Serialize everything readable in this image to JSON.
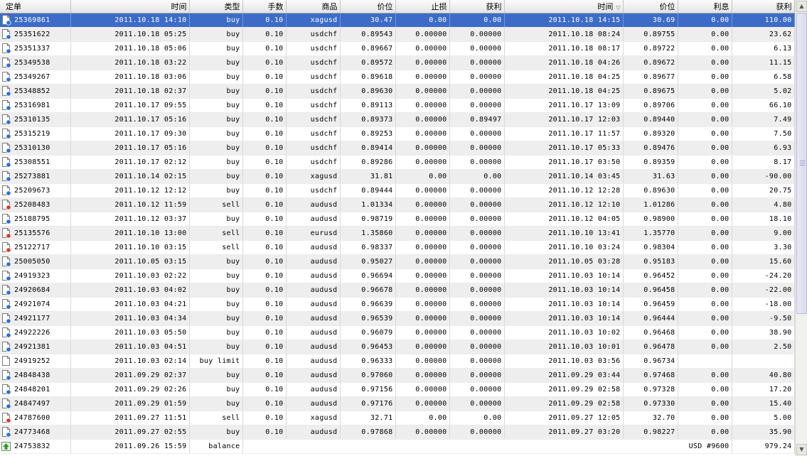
{
  "columns": [
    "定单",
    "时间",
    "类型",
    "手数",
    "商品",
    "价位",
    "止损",
    "获利",
    "时间",
    "价位",
    "利息",
    "获利"
  ],
  "rows": [
    {
      "ticket": "25369861",
      "open_time": "2011.10.18 14:10",
      "type": "buy",
      "lots": "0.10",
      "symbol": "xagusd",
      "open_price": "30.47",
      "sl": "0.00",
      "tp": "0.00",
      "close_time": "2011.10.18 14:15",
      "close_price": "30.69",
      "swap": "0.00",
      "profit": "110.00",
      "icon": "buy-order-icon"
    },
    {
      "ticket": "25351622",
      "open_time": "2011.10.18 05:25",
      "type": "buy",
      "lots": "0.10",
      "symbol": "usdchf",
      "open_price": "0.89543",
      "sl": "0.00000",
      "tp": "0.00000",
      "close_time": "2011.10.18 08:24",
      "close_price": "0.89755",
      "swap": "0.00",
      "profit": "23.62",
      "icon": "buy-order-icon"
    },
    {
      "ticket": "25351337",
      "open_time": "2011.10.18 05:06",
      "type": "buy",
      "lots": "0.10",
      "symbol": "usdchf",
      "open_price": "0.89667",
      "sl": "0.00000",
      "tp": "0.00000",
      "close_time": "2011.10.18 08:17",
      "close_price": "0.89722",
      "swap": "0.00",
      "profit": "6.13",
      "icon": "buy-order-icon"
    },
    {
      "ticket": "25349538",
      "open_time": "2011.10.18 03:22",
      "type": "buy",
      "lots": "0.10",
      "symbol": "usdchf",
      "open_price": "0.89572",
      "sl": "0.00000",
      "tp": "0.00000",
      "close_time": "2011.10.18 04:26",
      "close_price": "0.89672",
      "swap": "0.00",
      "profit": "11.15",
      "icon": "buy-order-icon"
    },
    {
      "ticket": "25349267",
      "open_time": "2011.10.18 03:06",
      "type": "buy",
      "lots": "0.10",
      "symbol": "usdchf",
      "open_price": "0.89618",
      "sl": "0.00000",
      "tp": "0.00000",
      "close_time": "2011.10.18 04:25",
      "close_price": "0.89677",
      "swap": "0.00",
      "profit": "6.58",
      "icon": "buy-order-icon"
    },
    {
      "ticket": "25348852",
      "open_time": "2011.10.18 02:37",
      "type": "buy",
      "lots": "0.10",
      "symbol": "usdchf",
      "open_price": "0.89630",
      "sl": "0.00000",
      "tp": "0.00000",
      "close_time": "2011.10.18 04:25",
      "close_price": "0.89675",
      "swap": "0.00",
      "profit": "5.02",
      "icon": "buy-order-icon"
    },
    {
      "ticket": "25316981",
      "open_time": "2011.10.17 09:55",
      "type": "buy",
      "lots": "0.10",
      "symbol": "usdchf",
      "open_price": "0.89113",
      "sl": "0.00000",
      "tp": "0.00000",
      "close_time": "2011.10.17 13:09",
      "close_price": "0.89706",
      "swap": "0.00",
      "profit": "66.10",
      "icon": "buy-order-icon"
    },
    {
      "ticket": "25310135",
      "open_time": "2011.10.17 05:16",
      "type": "buy",
      "lots": "0.10",
      "symbol": "usdchf",
      "open_price": "0.89373",
      "sl": "0.00000",
      "tp": "0.89497",
      "close_time": "2011.10.17 12:03",
      "close_price": "0.89440",
      "swap": "0.00",
      "profit": "7.49",
      "icon": "buy-order-icon"
    },
    {
      "ticket": "25315219",
      "open_time": "2011.10.17 09:30",
      "type": "buy",
      "lots": "0.10",
      "symbol": "usdchf",
      "open_price": "0.89253",
      "sl": "0.00000",
      "tp": "0.00000",
      "close_time": "2011.10.17 11:57",
      "close_price": "0.89320",
      "swap": "0.00",
      "profit": "7.50",
      "icon": "buy-order-icon"
    },
    {
      "ticket": "25310130",
      "open_time": "2011.10.17 05:16",
      "type": "buy",
      "lots": "0.10",
      "symbol": "usdchf",
      "open_price": "0.89414",
      "sl": "0.00000",
      "tp": "0.00000",
      "close_time": "2011.10.17 05:33",
      "close_price": "0.89476",
      "swap": "0.00",
      "profit": "6.93",
      "icon": "buy-order-icon"
    },
    {
      "ticket": "25308551",
      "open_time": "2011.10.17 02:12",
      "type": "buy",
      "lots": "0.10",
      "symbol": "usdchf",
      "open_price": "0.89286",
      "sl": "0.00000",
      "tp": "0.00000",
      "close_time": "2011.10.17 03:50",
      "close_price": "0.89359",
      "swap": "0.00",
      "profit": "8.17",
      "icon": "buy-order-icon"
    },
    {
      "ticket": "25273881",
      "open_time": "2011.10.14 02:15",
      "type": "buy",
      "lots": "0.10",
      "symbol": "xagusd",
      "open_price": "31.81",
      "sl": "0.00",
      "tp": "0.00",
      "close_time": "2011.10.14 03:45",
      "close_price": "31.63",
      "swap": "0.00",
      "profit": "-90.00",
      "icon": "buy-order-icon"
    },
    {
      "ticket": "25209673",
      "open_time": "2011.10.12 12:12",
      "type": "buy",
      "lots": "0.10",
      "symbol": "usdchf",
      "open_price": "0.89444",
      "sl": "0.00000",
      "tp": "0.00000",
      "close_time": "2011.10.12 12:28",
      "close_price": "0.89630",
      "swap": "0.00",
      "profit": "20.75",
      "icon": "buy-order-icon"
    },
    {
      "ticket": "25208483",
      "open_time": "2011.10.12 11:59",
      "type": "sell",
      "lots": "0.10",
      "symbol": "audusd",
      "open_price": "1.01334",
      "sl": "0.00000",
      "tp": "0.00000",
      "close_time": "2011.10.12 12:10",
      "close_price": "1.01286",
      "swap": "0.00",
      "profit": "4.80",
      "icon": "sell-order-icon"
    },
    {
      "ticket": "25188795",
      "open_time": "2011.10.12 03:37",
      "type": "buy",
      "lots": "0.10",
      "symbol": "audusd",
      "open_price": "0.98719",
      "sl": "0.00000",
      "tp": "0.00000",
      "close_time": "2011.10.12 04:05",
      "close_price": "0.98900",
      "swap": "0.00",
      "profit": "18.10",
      "icon": "buy-order-icon"
    },
    {
      "ticket": "25135576",
      "open_time": "2011.10.10 13:00",
      "type": "sell",
      "lots": "0.10",
      "symbol": "eurusd",
      "open_price": "1.35860",
      "sl": "0.00000",
      "tp": "0.00000",
      "close_time": "2011.10.10 13:41",
      "close_price": "1.35770",
      "swap": "0.00",
      "profit": "9.00",
      "icon": "sell-order-icon"
    },
    {
      "ticket": "25122717",
      "open_time": "2011.10.10 03:15",
      "type": "sell",
      "lots": "0.10",
      "symbol": "audusd",
      "open_price": "0.98337",
      "sl": "0.00000",
      "tp": "0.00000",
      "close_time": "2011.10.10 03:24",
      "close_price": "0.98304",
      "swap": "0.00",
      "profit": "3.30",
      "icon": "sell-order-icon"
    },
    {
      "ticket": "25005050",
      "open_time": "2011.10.05 03:15",
      "type": "buy",
      "lots": "0.10",
      "symbol": "audusd",
      "open_price": "0.95027",
      "sl": "0.00000",
      "tp": "0.00000",
      "close_time": "2011.10.05 03:28",
      "close_price": "0.95183",
      "swap": "0.00",
      "profit": "15.60",
      "icon": "buy-order-icon"
    },
    {
      "ticket": "24919323",
      "open_time": "2011.10.03 02:22",
      "type": "buy",
      "lots": "0.10",
      "symbol": "audusd",
      "open_price": "0.96694",
      "sl": "0.00000",
      "tp": "0.00000",
      "close_time": "2011.10.03 10:14",
      "close_price": "0.96452",
      "swap": "0.00",
      "profit": "-24.20",
      "icon": "buy-order-icon"
    },
    {
      "ticket": "24920684",
      "open_time": "2011.10.03 04:02",
      "type": "buy",
      "lots": "0.10",
      "symbol": "audusd",
      "open_price": "0.96678",
      "sl": "0.00000",
      "tp": "0.00000",
      "close_time": "2011.10.03 10:14",
      "close_price": "0.96458",
      "swap": "0.00",
      "profit": "-22.00",
      "icon": "buy-order-icon"
    },
    {
      "ticket": "24921074",
      "open_time": "2011.10.03 04:21",
      "type": "buy",
      "lots": "0.10",
      "symbol": "audusd",
      "open_price": "0.96639",
      "sl": "0.00000",
      "tp": "0.00000",
      "close_time": "2011.10.03 10:14",
      "close_price": "0.96459",
      "swap": "0.00",
      "profit": "-18.00",
      "icon": "buy-order-icon"
    },
    {
      "ticket": "24921177",
      "open_time": "2011.10.03 04:34",
      "type": "buy",
      "lots": "0.10",
      "symbol": "audusd",
      "open_price": "0.96539",
      "sl": "0.00000",
      "tp": "0.00000",
      "close_time": "2011.10.03 10:14",
      "close_price": "0.96444",
      "swap": "0.00",
      "profit": "-9.50",
      "icon": "buy-order-icon"
    },
    {
      "ticket": "24922226",
      "open_time": "2011.10.03 05:50",
      "type": "buy",
      "lots": "0.10",
      "symbol": "audusd",
      "open_price": "0.96079",
      "sl": "0.00000",
      "tp": "0.00000",
      "close_time": "2011.10.03 10:02",
      "close_price": "0.96468",
      "swap": "0.00",
      "profit": "38.90",
      "icon": "buy-order-icon"
    },
    {
      "ticket": "24921381",
      "open_time": "2011.10.03 04:51",
      "type": "buy",
      "lots": "0.10",
      "symbol": "audusd",
      "open_price": "0.96453",
      "sl": "0.00000",
      "tp": "0.00000",
      "close_time": "2011.10.03 10:01",
      "close_price": "0.96478",
      "swap": "0.00",
      "profit": "2.50",
      "icon": "buy-order-icon"
    },
    {
      "ticket": "24919252",
      "open_time": "2011.10.03 02:14",
      "type": "buy limit",
      "lots": "0.10",
      "symbol": "audusd",
      "open_price": "0.96333",
      "sl": "0.00000",
      "tp": "0.00000",
      "close_time": "2011.10.03 03:56",
      "close_price": "0.96734",
      "swap": "",
      "profit": "",
      "icon": "pending-order-icon"
    },
    {
      "ticket": "24848438",
      "open_time": "2011.09.29 02:37",
      "type": "buy",
      "lots": "0.10",
      "symbol": "audusd",
      "open_price": "0.97060",
      "sl": "0.00000",
      "tp": "0.00000",
      "close_time": "2011.09.29 03:44",
      "close_price": "0.97468",
      "swap": "0.00",
      "profit": "40.80",
      "icon": "buy-order-icon"
    },
    {
      "ticket": "24848201",
      "open_time": "2011.09.29 02:26",
      "type": "buy",
      "lots": "0.10",
      "symbol": "audusd",
      "open_price": "0.97156",
      "sl": "0.00000",
      "tp": "0.00000",
      "close_time": "2011.09.29 02:58",
      "close_price": "0.97328",
      "swap": "0.00",
      "profit": "17.20",
      "icon": "buy-order-icon"
    },
    {
      "ticket": "24847497",
      "open_time": "2011.09.29 01:59",
      "type": "buy",
      "lots": "0.10",
      "symbol": "audusd",
      "open_price": "0.97176",
      "sl": "0.00000",
      "tp": "0.00000",
      "close_time": "2011.09.29 02:58",
      "close_price": "0.97330",
      "swap": "0.00",
      "profit": "15.40",
      "icon": "buy-order-icon"
    },
    {
      "ticket": "24787600",
      "open_time": "2011.09.27 11:51",
      "type": "sell",
      "lots": "0.10",
      "symbol": "xagusd",
      "open_price": "32.71",
      "sl": "0.00",
      "tp": "0.00",
      "close_time": "2011.09.27 12:05",
      "close_price": "32.70",
      "swap": "0.00",
      "profit": "5.00",
      "icon": "sell-order-icon"
    },
    {
      "ticket": "24773468",
      "open_time": "2011.09.27 02:55",
      "type": "buy",
      "lots": "0.10",
      "symbol": "audusd",
      "open_price": "0.97868",
      "sl": "0.00000",
      "tp": "0.00000",
      "close_time": "2011.09.27 03:20",
      "close_price": "0.98227",
      "swap": "0.00",
      "profit": "35.90",
      "icon": "buy-order-icon"
    }
  ],
  "balance_row": {
    "ticket": "24753832",
    "open_time": "2011.09.26 15:59",
    "type": "balance",
    "comment": "USD #9600",
    "profit": "979.24",
    "icon": "deposit-arrow-icon"
  },
  "selected_index": 0,
  "colors": {
    "selection": "#3c6cc8",
    "buy_icon": "#2a6fd6",
    "sell_icon": "#d83a20",
    "deposit_icon": "#2e9a2e"
  }
}
